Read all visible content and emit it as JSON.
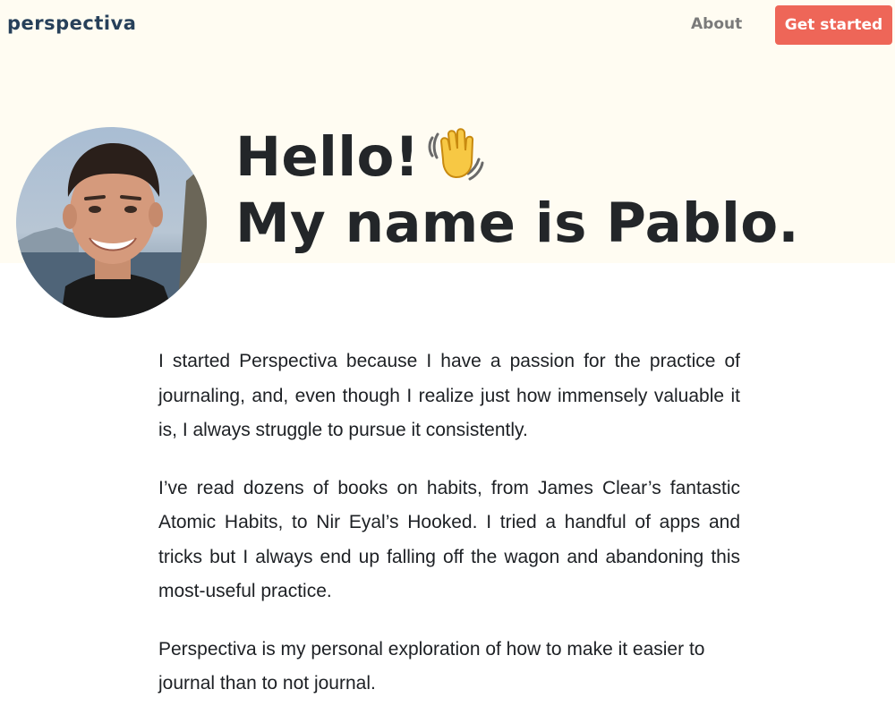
{
  "header": {
    "brand": "perspectiva",
    "nav_about": "About",
    "cta_label": "Get started"
  },
  "hero": {
    "line1": "Hello!",
    "line2": "My name is Pablo.",
    "emoji_icon": "waving-hand-icon",
    "avatar_alt": "avatar"
  },
  "content": {
    "paragraphs": [
      "I started Perspectiva because I have a passion for the practice of journaling, and, even though I realize just how immensely valuable it is, I always struggle to pursue it consistently.",
      "I’ve read dozens of books on habits, from James Clear’s fantastic Atomic Habits, to Nir Eyal’s Hooked. I tried a handful of apps and tricks but I always end up falling off the wagon and abandoning this most-useful practice.",
      "Perspectiva is my personal exploration of how to make it easier to journal than to not journal."
    ]
  },
  "colors": {
    "hero_band": "#fffcf2",
    "brand": "#27405a",
    "cta_bg": "#ee6658",
    "nav_text": "#7a7a7a",
    "heading": "#232629"
  }
}
